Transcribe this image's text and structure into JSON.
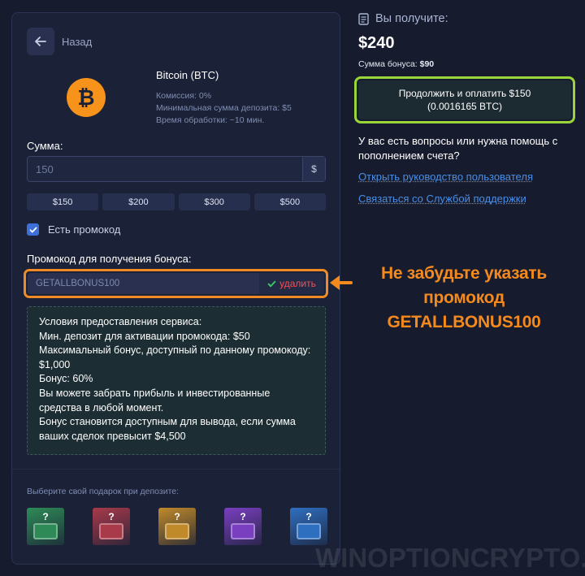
{
  "back": {
    "label": "Назад"
  },
  "coin": {
    "name": "Bitcoin (BTC)",
    "symbol": "₿",
    "commission": "Комиссия: 0%",
    "min_deposit": "Минимальная сумма депозита: $5",
    "processing_time": "Время обработки: ~10 мин."
  },
  "amount": {
    "label": "Сумма:",
    "placeholder": "150",
    "currency": "$",
    "quick": [
      "$150",
      "$200",
      "$300",
      "$500"
    ]
  },
  "promo_toggle": {
    "label": "Есть промокод",
    "checked": true
  },
  "promo": {
    "label": "Промокод для получения бонуса:",
    "value": "GETALLBONUS100",
    "delete_label": "удалить"
  },
  "terms": [
    "Условия предоставления сервиса:",
    "Мин. депозит для активации промокода: $50",
    "Максимальный бонус, доступный по данному промокоду: $1,000",
    "Бонус: 60%",
    "Вы можете забрать прибыль и инвестированные средства в любой момент.",
    "Бонус становится доступным для вывода, если сумма ваших сделок превысит $4,500"
  ],
  "gifts": {
    "label": "Выберите свой подарок при депозите:",
    "items": [
      {
        "icon": "chest-green-icon",
        "color": "#2e8b57"
      },
      {
        "icon": "chest-red-icon",
        "color": "#a83a4a"
      },
      {
        "icon": "chest-gold-icon",
        "color": "#c08a2a"
      },
      {
        "icon": "chest-purple-icon",
        "color": "#7a3fc0"
      },
      {
        "icon": "chest-blue-icon",
        "color": "#2f6fc0"
      }
    ]
  },
  "summary": {
    "title": "Вы получите:",
    "amount": "$240",
    "bonus_label": "Сумма бонуса: ",
    "bonus_value": "$90",
    "pay_line1": "Продолжить и оплатить $150",
    "pay_line2": "(0.0016165 BTC)"
  },
  "help": {
    "text": "У вас есть вопросы или нужна помощь с пополнением счета?",
    "guide_link": "Открыть руководство пользователя",
    "support_link": "Связаться со Службой поддержки"
  },
  "callout": {
    "line1": "Не забудьте указать",
    "line2": "промокод GETALLBONUS100"
  },
  "watermark": "WINOPTIONCRYPTO.COM",
  "colors": {
    "accent_orange": "#f08a24",
    "accent_green": "#9ad63a",
    "link": "#4a8ee6",
    "delete": "#ff4d4d"
  }
}
